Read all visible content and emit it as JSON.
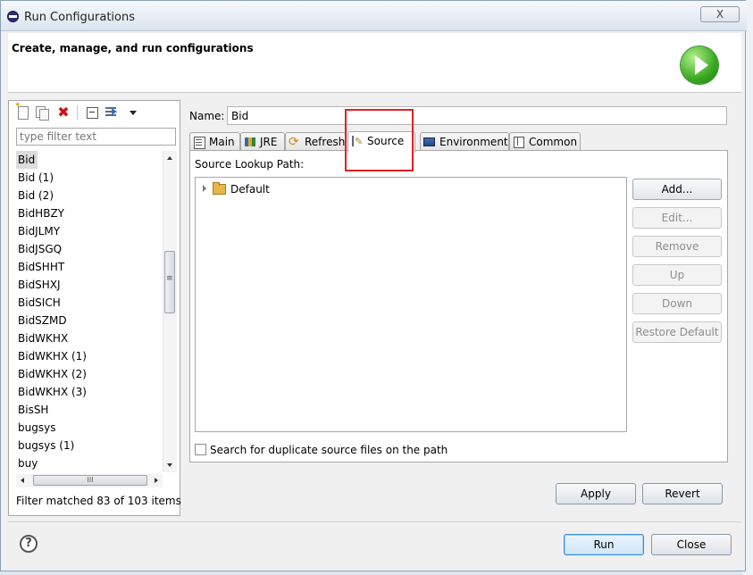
{
  "window": {
    "title": "Run Configurations",
    "close_glyph": "X"
  },
  "header": {
    "title": "Create, manage, and run configurations"
  },
  "toolbar": {
    "icons": [
      "new-configuration-icon",
      "duplicate-icon",
      "delete-icon",
      "collapse-all-icon",
      "filter-icon",
      "view-menu-icon"
    ],
    "delete_glyph": "✖"
  },
  "filter": {
    "placeholder": "type filter text",
    "value": ""
  },
  "configurations": {
    "items": [
      "Bid",
      "Bid (1)",
      "Bid (2)",
      "BidHBZY",
      "BidJLMY",
      "BidJSGQ",
      "BidSHHT",
      "BidSHXJ",
      "BidSICH",
      "BidSZMD",
      "BidWKHX",
      "BidWKHX (1)",
      "BidWKHX (2)",
      "BidWKHX (3)",
      "BisSH",
      "bugsys",
      "bugsys (1)",
      "buy"
    ],
    "selected": "Bid",
    "status": "Filter matched 83 of 103 items"
  },
  "editor": {
    "name_label": "Name:",
    "name_value": "Bid",
    "tabs": [
      {
        "label": "Main",
        "icon": "main-tab-icon"
      },
      {
        "label": "JRE",
        "icon": "jre-tab-icon"
      },
      {
        "label": "Refresh",
        "icon": "refresh-tab-icon"
      },
      {
        "label": "Source",
        "icon": "source-tab-icon"
      },
      {
        "label": "Environment",
        "icon": "environment-tab-icon"
      },
      {
        "label": "Common",
        "icon": "common-tab-icon"
      }
    ],
    "active_tab": "Source",
    "source_lookup_label": "Source Lookup Path:",
    "tree": [
      {
        "label": "Default",
        "expanded": false
      }
    ],
    "side_buttons": {
      "add": "Add...",
      "edit": "Edit...",
      "remove": "Remove",
      "up": "Up",
      "down": "Down",
      "restore": "Restore Default"
    },
    "duplicate_checkbox_label": "Search for duplicate source files on the path",
    "duplicate_checked": false,
    "apply": "Apply",
    "revert": "Revert"
  },
  "footer": {
    "help_glyph": "?",
    "run": "Run",
    "close": "Close"
  },
  "scrollbar": {
    "h_thumb_glyph": "III"
  },
  "colors": {
    "highlight": "#e02020",
    "run_accent": "#39a823"
  }
}
